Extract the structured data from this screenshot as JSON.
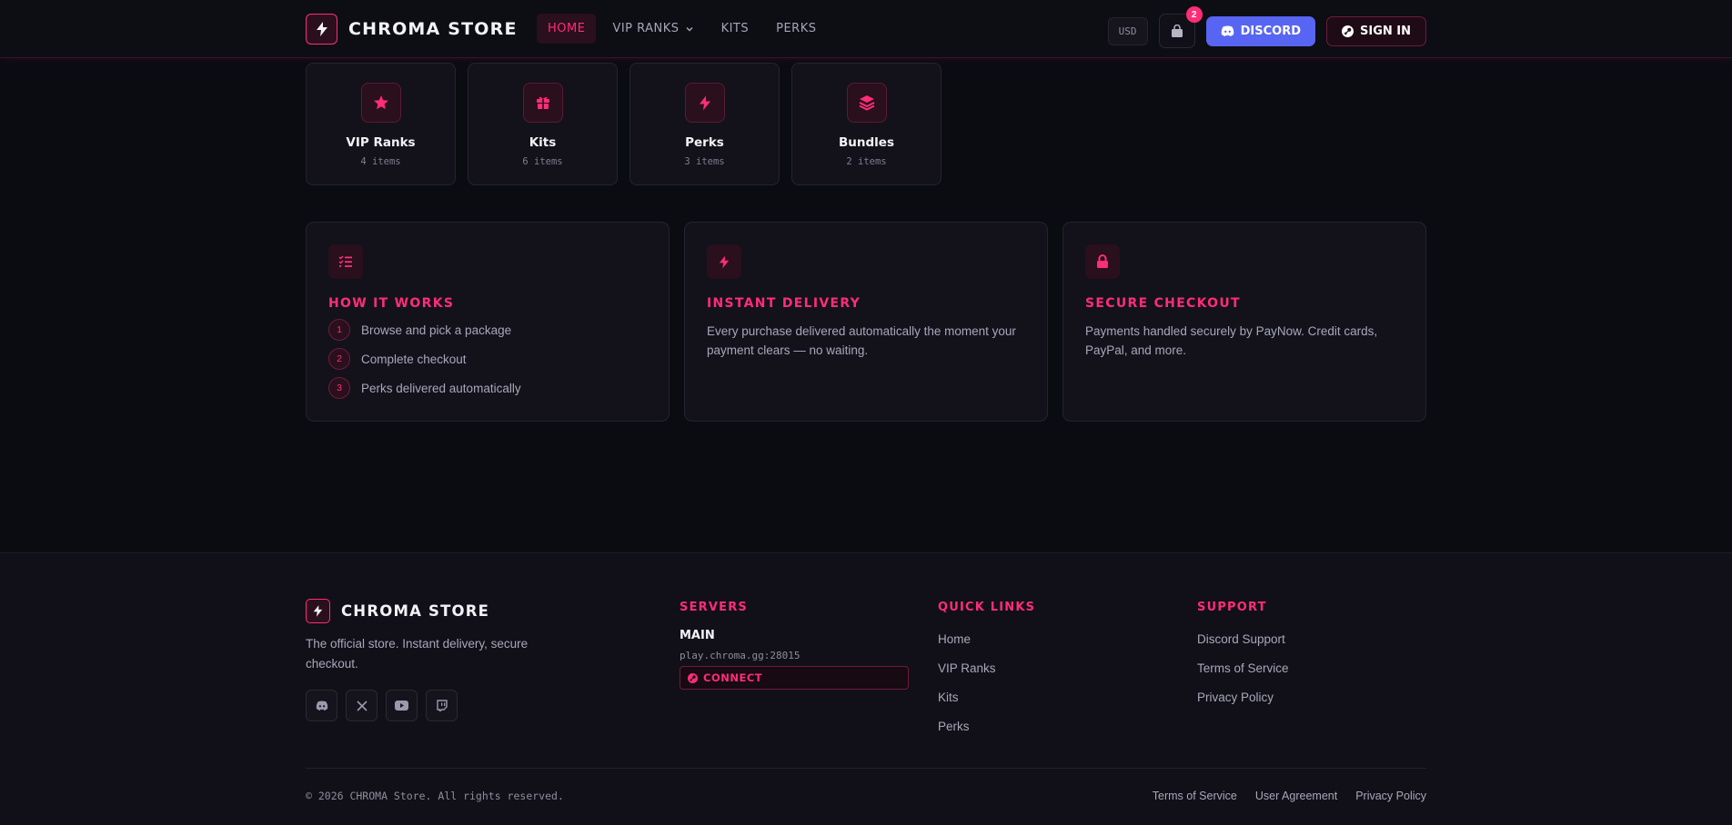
{
  "brand": {
    "name": "CHROMA STORE",
    "icon": "bolt-icon"
  },
  "nav": {
    "links": [
      {
        "label": "HOME",
        "active": true
      },
      {
        "label": "VIP RANKS",
        "dropdown": true
      },
      {
        "label": "KITS"
      },
      {
        "label": "PERKS"
      }
    ],
    "currency": "USD",
    "cart_count": "2",
    "discord_label": "DISCORD",
    "signin_label": "SIGN IN"
  },
  "categories": [
    {
      "name": "VIP Ranks",
      "count": "4 items",
      "icon": "star-icon"
    },
    {
      "name": "Kits",
      "count": "6 items",
      "icon": "gift-icon"
    },
    {
      "name": "Perks",
      "count": "3 items",
      "icon": "bolt-icon"
    },
    {
      "name": "Bundles",
      "count": "2 items",
      "icon": "layers-icon"
    }
  ],
  "info": {
    "how": {
      "title": "HOW IT WORKS",
      "icon": "checklist-icon",
      "steps": [
        {
          "num": "1",
          "text": "Browse and pick a package"
        },
        {
          "num": "2",
          "text": "Complete checkout"
        },
        {
          "num": "3",
          "text": "Perks delivered automatically"
        }
      ]
    },
    "delivery": {
      "title": "INSTANT DELIVERY",
      "icon": "bolt-icon",
      "text": "Every purchase delivered automatically the moment your payment clears — no waiting."
    },
    "secure": {
      "title": "SECURE CHECKOUT",
      "icon": "lock-icon",
      "text": "Payments handled securely by PayNow. Credit cards, PayPal, and more."
    }
  },
  "footer": {
    "brand_name": "CHROMA STORE",
    "description": "The official store. Instant delivery, secure checkout.",
    "socials": [
      "discord-icon",
      "x-icon",
      "youtube-icon",
      "twitch-icon"
    ],
    "servers": {
      "title": "SERVERS",
      "name": "MAIN",
      "address": "play.chroma.gg:28015",
      "connect_label": "CONNECT"
    },
    "quick_links": {
      "title": "QUICK LINKS",
      "items": [
        "Home",
        "VIP Ranks",
        "Kits",
        "Perks"
      ]
    },
    "support": {
      "title": "SUPPORT",
      "items": [
        "Discord Support",
        "Terms of Service",
        "Privacy Policy"
      ]
    },
    "copyright": "© 2026 CHROMA Store. All rights reserved.",
    "legal": [
      "Terms of Service",
      "User Agreement",
      "Privacy Policy"
    ]
  },
  "colors": {
    "accent": "#ff2d78",
    "discord": "#5865f2",
    "background": "#0b0b12"
  }
}
